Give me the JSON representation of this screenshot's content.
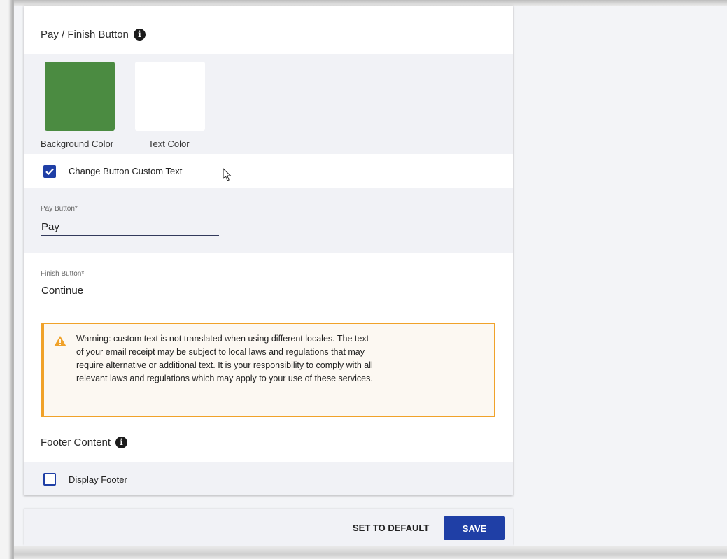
{
  "pay_finish_section": {
    "title": "Pay / Finish Button",
    "info_icon": "info-icon",
    "background_color_label": "Background Color",
    "background_color": "#4b8b41",
    "text_color_label": "Text Color",
    "text_color": "#ffffff",
    "custom_text_checkbox": {
      "label": "Change Button Custom Text",
      "checked": true
    },
    "pay_button_field": {
      "label": "Pay Button*",
      "value": "Pay"
    },
    "finish_button_field": {
      "label": "Finish Button*",
      "value": "Continue"
    },
    "warning": {
      "icon": "warning-triangle-icon",
      "text": "Warning: custom text is not translated when using different locales. The text of your email receipt may be subject to local laws and regulations that may require alternative or additional text. It is your responsibility to comply with all relevant laws and regulations which may apply to your use of these services."
    }
  },
  "footer_section": {
    "title": "Footer Content",
    "info_icon": "info-icon",
    "display_footer_checkbox": {
      "label": "Display Footer",
      "checked": false
    }
  },
  "actions": {
    "set_default_label": "SET TO DEFAULT",
    "save_label": "SAVE"
  },
  "colors": {
    "primary": "#1f3fa6",
    "warning_accent": "#f0a22a",
    "section_grey": "#f1f2f6"
  }
}
